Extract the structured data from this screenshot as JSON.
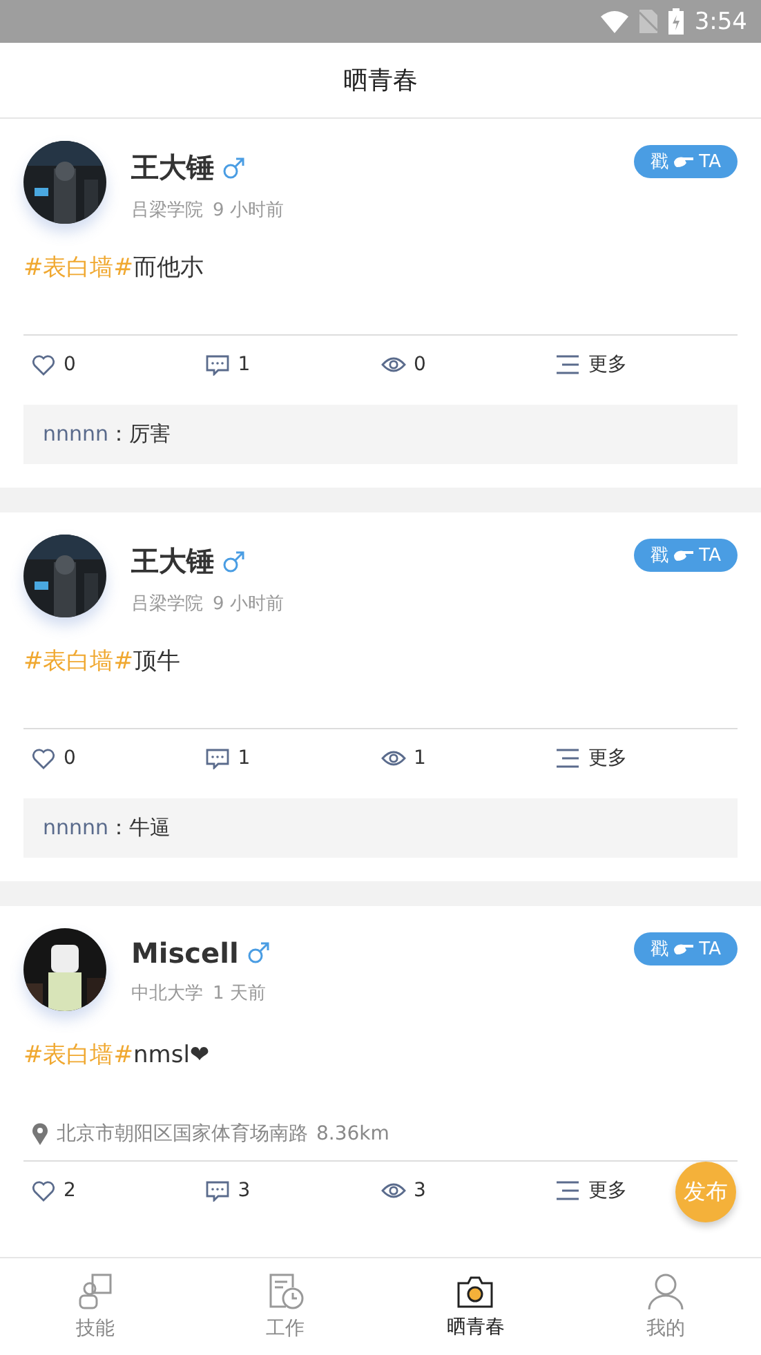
{
  "status_bar": {
    "time": "3:54"
  },
  "header": {
    "title": "晒青春"
  },
  "posts": [
    {
      "name": "王大锤",
      "school": "吕梁学院",
      "time": "9 小时前",
      "poke": {
        "before": "戳",
        "after": "TA"
      },
      "tag": "#表白墙#",
      "text": "而他朩",
      "likes": "0",
      "comments": "1",
      "views": "0",
      "more": "更多",
      "replies": [
        {
          "user": "nnnnn",
          "text": "：厉害"
        }
      ]
    },
    {
      "name": "王大锤",
      "school": "吕梁学院",
      "time": "9 小时前",
      "poke": {
        "before": "戳",
        "after": "TA"
      },
      "tag": "#表白墙#",
      "text": "顶牛",
      "likes": "0",
      "comments": "1",
      "views": "1",
      "more": "更多",
      "replies": [
        {
          "user": "nnnnn",
          "text": "：牛逼"
        }
      ]
    },
    {
      "name": "Miscell",
      "school": "中北大学",
      "time": "1 天前",
      "poke": {
        "before": "戳",
        "after": "TA"
      },
      "tag": "#表白墙#",
      "text": "nmsl❤",
      "location": "北京市朝阳区国家体育场南路",
      "distance": "8.36km",
      "likes": "2",
      "comments": "3",
      "views": "3",
      "more": "更多"
    }
  ],
  "fab": {
    "label": "发布"
  },
  "nav": [
    {
      "kind": "skills",
      "label": "技能",
      "selected": false
    },
    {
      "kind": "work",
      "label": "工作",
      "selected": false
    },
    {
      "kind": "camera",
      "label": "晒青春",
      "selected": true
    },
    {
      "kind": "profile",
      "label": "我的",
      "selected": false
    }
  ]
}
